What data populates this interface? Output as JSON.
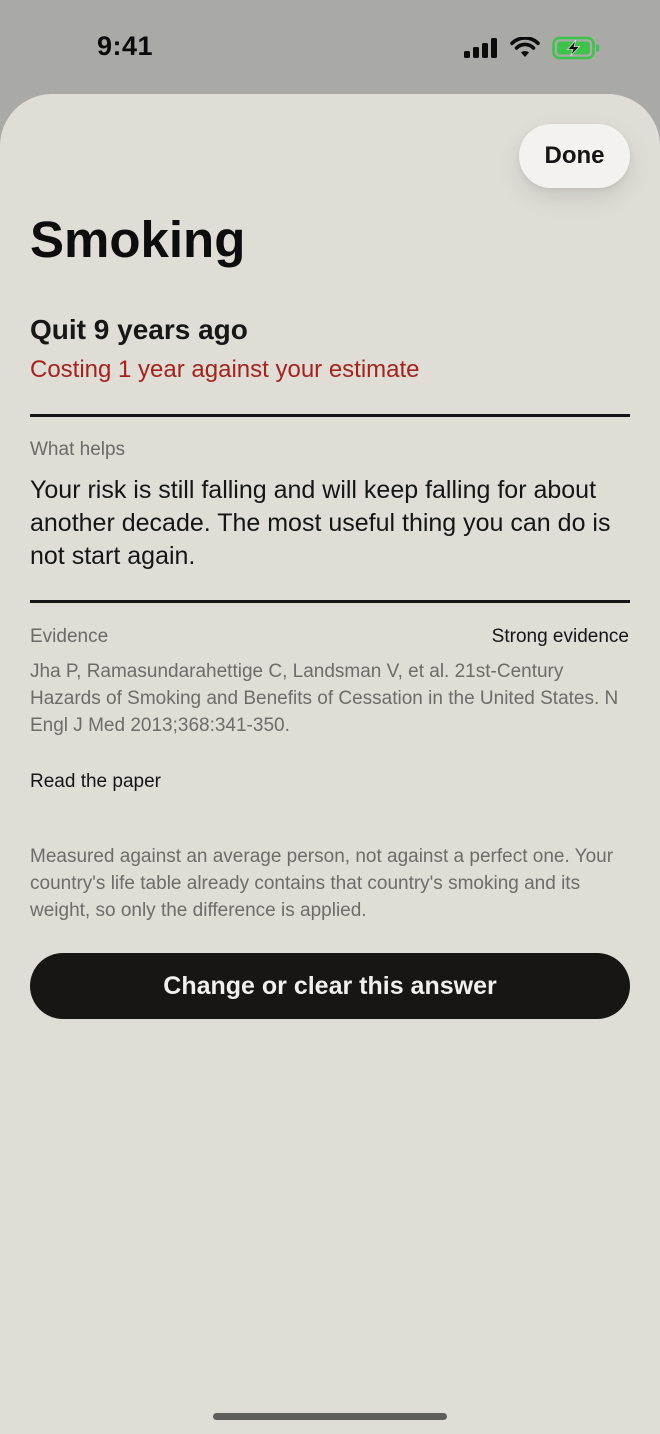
{
  "status_bar": {
    "time": "9:41",
    "icons": [
      "signal-icon",
      "wifi-icon",
      "battery-charging-icon"
    ],
    "battery_color": "#3dc24a"
  },
  "sheet": {
    "done_label": "Done",
    "title": "Smoking",
    "status": "Quit 9 years ago",
    "cost": "Costing 1 year against your estimate",
    "what_helps": {
      "label": "What helps",
      "text": "Your risk is still falling and will keep falling for about another decade. The most useful thing you can do is not start again."
    },
    "evidence": {
      "label": "Evidence",
      "strength": "Strong evidence",
      "citation": "Jha P, Ramasundarahettige C, Landsman V, et al. 21st-Century Hazards of Smoking and Benefits of Cessation in the United States. N Engl J Med 2013;368:341-350.",
      "link_label": "Read the paper"
    },
    "disclaimer": "Measured against an average person, not against a perfect one. Your country's life table already contains that country's smoking and its weight, so only the difference is applied.",
    "primary_action": "Change or clear this answer"
  },
  "colors": {
    "sheet_background": "#e0ddd7",
    "accent_red": "#a3231d",
    "button_dark": "#171613"
  }
}
